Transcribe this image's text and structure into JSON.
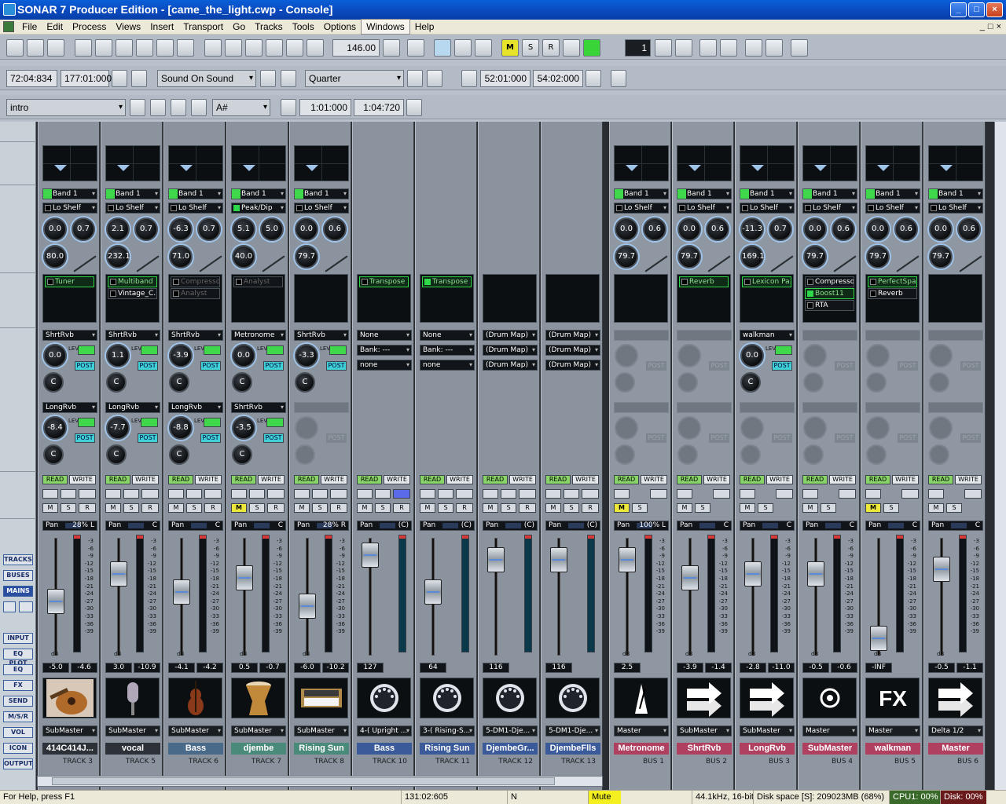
{
  "window": {
    "title": "SONAR 7 Producer Edition - [came_the_light.cwp - Console]"
  },
  "menu": [
    "File",
    "Edit",
    "Process",
    "Views",
    "Insert",
    "Transport",
    "Go",
    "Tracks",
    "Tools",
    "Options",
    "Windows",
    "Help"
  ],
  "transport": {
    "tempo": "146.00",
    "now_time": "72:04:834",
    "end_time": "177:01:000",
    "sound_on_sound": "Sound On Sound",
    "snap": "Quarter",
    "loop_start": "52:01:000",
    "loop_end": "54:02:000",
    "marker": "intro",
    "key": "A#",
    "sel_start": "1:01:000",
    "sel_end": "1:04:720",
    "meter_count": "1",
    "msr_buttons": [
      "M",
      "S",
      "R"
    ]
  },
  "left_panel": [
    "TRACKS",
    "BUSES",
    "MAINS",
    "INPUT",
    "EQ PLOT",
    "EQ",
    "FX",
    "SEND",
    "M/S/R",
    "VOL",
    "ICON",
    "OUTPUT"
  ],
  "strip_labels": {
    "band": "Band 1",
    "read": "READ",
    "write": "WRITE",
    "pan": "Pan",
    "m": "M",
    "s": "S",
    "r": "R",
    "post": "POST",
    "lev": "LEV",
    "db": "dB",
    "scale": [
      "-3",
      "-6",
      "-9",
      "-12",
      "-15",
      "-18",
      "-21",
      "-24",
      "-27",
      "-30",
      "-33",
      "-36",
      "-39"
    ]
  },
  "strips": [
    {
      "name": "414C414J...",
      "num": "TRACK 3",
      "color": "#2c3238",
      "shape": "Lo Shelf",
      "k1": "0.0",
      "k2": "0.7",
      "k3": "80.0",
      "fx": [
        {
          "t": "Tuner",
          "on": false,
          "sel": true
        }
      ],
      "send1": "ShrtRvb",
      "s1": "0.0",
      "send2": "LongRvb",
      "s2": "-8.4",
      "pan": "28% L",
      "v1": "-5.0",
      "v2": "-4.6",
      "out": "SubMaster",
      "img": "guitar",
      "fader": 0.55
    },
    {
      "name": "vocal",
      "num": "TRACK 5",
      "color": "#2c3238",
      "shape": "Lo Shelf",
      "k1": "2.1",
      "k2": "0.7",
      "k3": "232.1",
      "fx": [
        {
          "t": "Multiband",
          "on": false,
          "sel": true
        },
        {
          "t": "Vintage_C...",
          "on": false,
          "sel": false
        }
      ],
      "send1": "ShrtRvb",
      "s1": "1.1",
      "send2": "LongRvb",
      "s2": "-7.7",
      "pan": "C",
      "v1": "3.0",
      "v2": "-10.9",
      "out": "SubMaster",
      "img": "mic",
      "fader": 0.25
    },
    {
      "name": "Bass",
      "num": "TRACK 6",
      "color": "#4a6a8a",
      "shape": "Lo Shelf",
      "k1": "-6.3",
      "k2": "0.7",
      "k3": "71.0",
      "fx": [
        {
          "t": "Compressor",
          "on": false,
          "sel": false,
          "dim": true
        },
        {
          "t": "Analyst",
          "on": false,
          "sel": false,
          "dim": true
        }
      ],
      "send1": "ShrtRvb",
      "s1": "-3.9",
      "send2": "LongRvb",
      "s2": "-8.8",
      "pan": "C",
      "v1": "-4.1",
      "v2": "-4.2",
      "out": "SubMaster",
      "img": "bass",
      "fader": 0.45
    },
    {
      "name": "djembe",
      "num": "TRACK 7",
      "color": "#4a8a7a",
      "shape": "Peak/Dip",
      "k1": "5.1",
      "k2": "5.0",
      "k3": "40.0",
      "fx": [
        {
          "t": "Analyst",
          "on": false,
          "sel": false,
          "dim": true
        }
      ],
      "send1": "Metronome",
      "s1": "0.0",
      "send2": "ShrtRvb",
      "s2": "-3.5",
      "pan": "C",
      "v1": "0.5",
      "v2": "-0.7",
      "out": "SubMaster",
      "img": "djembe",
      "fader": 0.3
    },
    {
      "name": "Rising Sun",
      "num": "TRACK 8",
      "color": "#4a8a7a",
      "shape": "Lo Shelf",
      "k1": "0.0",
      "k2": "0.6",
      "k3": "79.7",
      "fx": [],
      "send1": "ShrtRvb",
      "s1": "-3.3",
      "send2": "",
      "s2": "",
      "pan": "28% R",
      "v1": "-6.0",
      "v2": "-10.2",
      "out": "SubMaster",
      "img": "synth",
      "fader": 0.6
    },
    {
      "name": "Bass",
      "num": "TRACK 10",
      "color": "#3a5a9a",
      "midi": true,
      "fx": [
        {
          "t": "Transpose",
          "on": false,
          "sel": true
        }
      ],
      "patch": [
        "None",
        "Bank: ---",
        "none"
      ],
      "pan": "(C)",
      "v1": "127",
      "out": "4-( Upright ...",
      "img": "midi",
      "fader": 0.05
    },
    {
      "name": "Rising Sun",
      "num": "TRACK 11",
      "color": "#3a5a9a",
      "midi": true,
      "fx": [
        {
          "t": "Transpose",
          "on": true,
          "sel": true
        }
      ],
      "patch": [
        "None",
        "Bank: ---",
        "none"
      ],
      "pan": "(C)",
      "v1": "64",
      "out": "3-( Rising-S...",
      "img": "midi",
      "fader": 0.45
    },
    {
      "name": "DjembeGr...",
      "num": "TRACK 12",
      "color": "#3a5a9a",
      "midi": true,
      "fx": [],
      "patch": [
        "(Drum Map)",
        "(Drum Map)",
        "(Drum Map)"
      ],
      "pan": "(C)",
      "v1": "116",
      "out": "5-DM1-Dje...",
      "img": "midi",
      "fader": 0.1
    },
    {
      "name": "DjembeFlls",
      "num": "TRACK 13",
      "color": "#3a5a9a",
      "midi": true,
      "fx": [],
      "patch": [
        "(Drum Map)",
        "(Drum Map)",
        "(Drum Map)"
      ],
      "pan": "(C)",
      "v1": "116",
      "out": "5-DM1-Dje...",
      "img": "midi",
      "fader": 0.1
    },
    {
      "name": "Metronome",
      "num": "BUS 1",
      "color": "#b04060",
      "bus": true,
      "shape": "Lo Shelf",
      "k1": "0.0",
      "k2": "0.6",
      "k3": "79.7",
      "fx": [],
      "send1": "",
      "pan": "100% L",
      "v1": "2.5",
      "out": "Master",
      "img": "metronome",
      "fader": 0.1
    },
    {
      "name": "ShrtRvb",
      "num": "BUS 2",
      "color": "#b04060",
      "bus": true,
      "shape": "Lo Shelf",
      "k1": "0.0",
      "k2": "0.6",
      "k3": "79.7",
      "fx": [
        {
          "t": "Reverb",
          "on": false,
          "sel": true
        }
      ],
      "send1": "",
      "pan": "C",
      "v1": "-3.9",
      "v2": "-1.4",
      "out": "SubMaster",
      "img": "arrow",
      "fader": 0.3
    },
    {
      "name": "LongRvb",
      "num": "BUS 3",
      "color": "#b04060",
      "bus": true,
      "shape": "Lo Shelf",
      "k1": "-11.3",
      "k2": "0.7",
      "k3": "169.1",
      "fx": [
        {
          "t": "Lexicon Pa...",
          "on": false,
          "sel": true
        }
      ],
      "send1": "walkman",
      "s1": "0.0",
      "pan": "C",
      "v1": "-2.8",
      "v2": "-11.0",
      "out": "SubMaster",
      "img": "arrow",
      "fader": 0.25
    },
    {
      "name": "SubMaster",
      "num": "BUS 4",
      "color": "#b04060",
      "bus": true,
      "shape": "Lo Shelf",
      "k1": "0.0",
      "k2": "0.6",
      "k3": "79.7",
      "fx": [
        {
          "t": "Compressor",
          "on": false,
          "sel": false
        },
        {
          "t": "Boost11",
          "on": true,
          "sel": true
        },
        {
          "t": "RTA",
          "on": false,
          "sel": false
        }
      ],
      "send1": "",
      "pan": "C",
      "v1": "-0.5",
      "v2": "-0.6",
      "out": "Master",
      "img": "target",
      "fader": 0.25
    },
    {
      "name": "walkman",
      "num": "BUS 5",
      "color": "#b04060",
      "bus": true,
      "shape": "Lo Shelf",
      "k1": "0.0",
      "k2": "0.6",
      "k3": "79.7",
      "fx": [
        {
          "t": "PerfectSpace",
          "on": false,
          "sel": true
        },
        {
          "t": "Reverb",
          "on": false,
          "sel": false
        }
      ],
      "send1": "",
      "pan": "C",
      "v1": "-INF",
      "out": "Master",
      "img": "fx",
      "fader": 0.95
    },
    {
      "name": "Master",
      "num": "BUS 6",
      "color": "#b04060",
      "bus": true,
      "shape": "Lo Shelf",
      "k1": "0.0",
      "k2": "0.6",
      "k3": "79.7",
      "fx": [],
      "send1": "",
      "pan": "C",
      "v1": "-0.5",
      "v2": "-1.1",
      "out": "Delta 1/2",
      "img": "arrow",
      "fader": 0.2
    }
  ],
  "status": {
    "help": "For Help, press F1",
    "time": "131:02:605",
    "n": "N",
    "mute": "Mute",
    "rate": "44.1kHz, 16-bit",
    "disk": "Disk space [S]: 209023MB (68%)",
    "cpu": "CPU1: 00%",
    "diskuse": "Disk: 00%"
  }
}
